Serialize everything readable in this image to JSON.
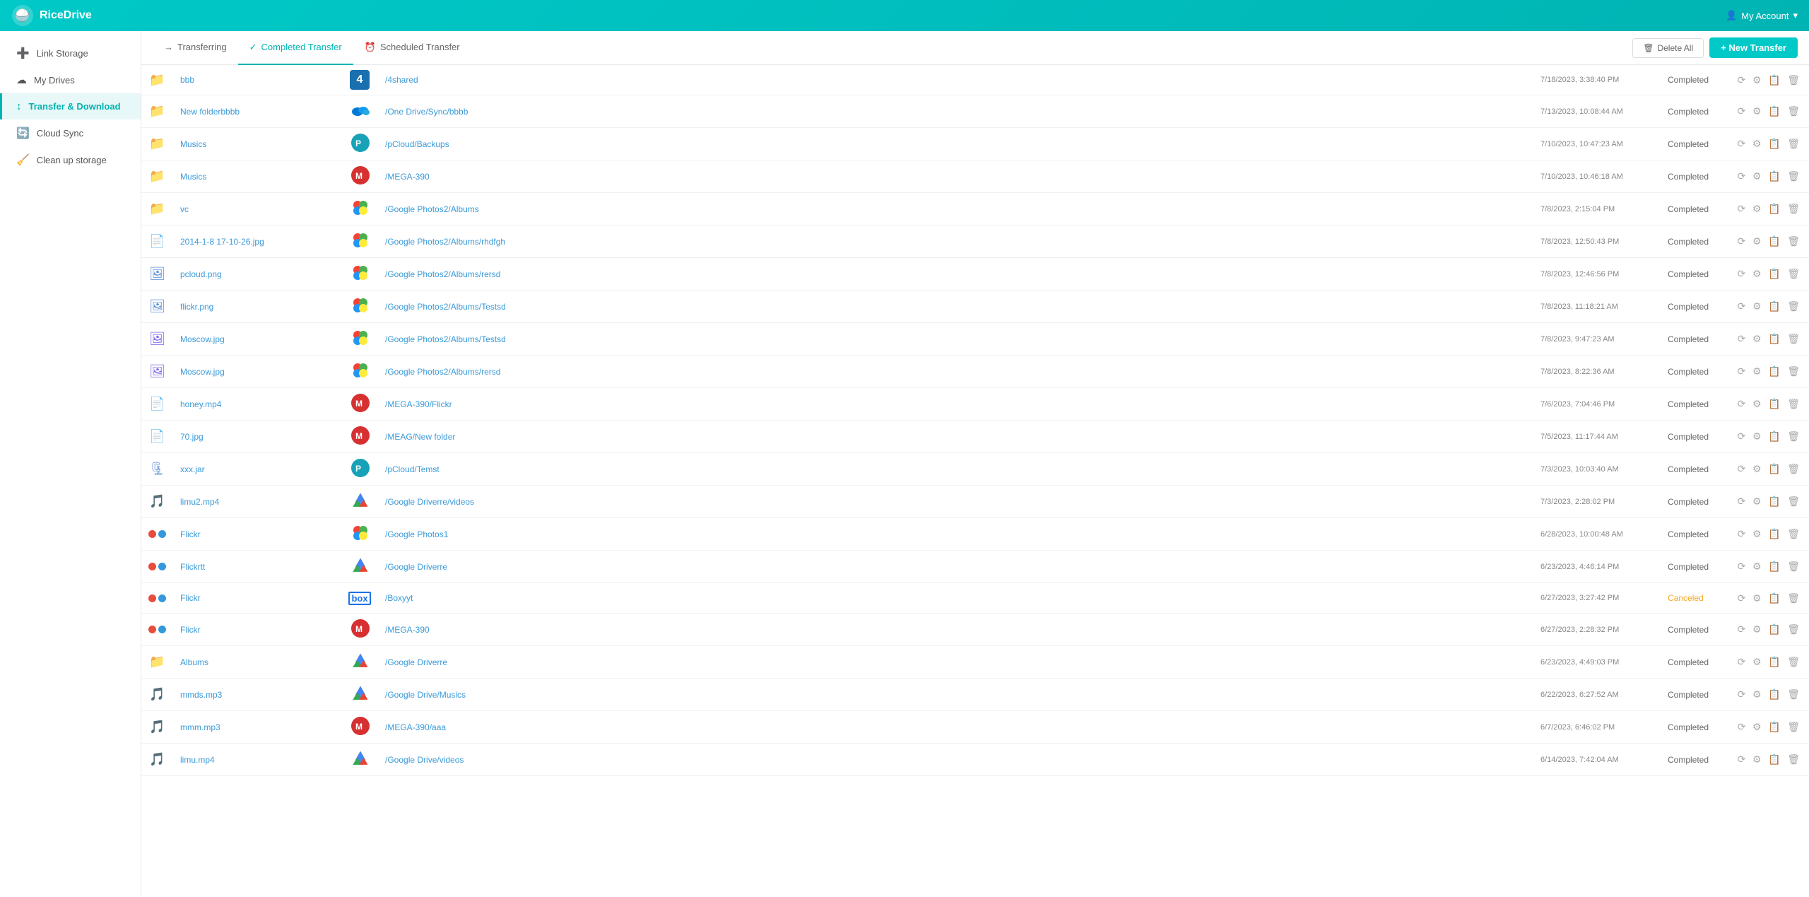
{
  "app": {
    "title": "RiceDrive",
    "logo_alt": "RiceDrive Logo"
  },
  "header": {
    "account_label": "My Account"
  },
  "sidebar": {
    "items": [
      {
        "id": "link-storage",
        "label": "Link Storage",
        "icon": "➕",
        "active": false
      },
      {
        "id": "my-drives",
        "label": "My Drives",
        "icon": "☁",
        "active": false
      },
      {
        "id": "transfer-download",
        "label": "Transfer & Download",
        "icon": "↕",
        "active": true
      },
      {
        "id": "cloud-sync",
        "label": "Cloud Sync",
        "icon": "🔄",
        "active": false
      },
      {
        "id": "clean-up-storage",
        "label": "Clean up storage",
        "icon": "🧹",
        "active": false
      }
    ]
  },
  "tabs": [
    {
      "id": "transferring",
      "label": "Transferring",
      "icon": "→",
      "active": false
    },
    {
      "id": "completed-transfer",
      "label": "Completed Transfer",
      "icon": "✓",
      "active": true
    },
    {
      "id": "scheduled-transfer",
      "label": "Scheduled Transfer",
      "icon": "⏰",
      "active": false
    }
  ],
  "toolbar": {
    "delete_all_label": "Delete All",
    "new_transfer_label": "+ New Transfer"
  },
  "table": {
    "rows": [
      {
        "id": 1,
        "file_icon": "folder",
        "name": "bbb",
        "source_type": "4shared",
        "destination": "/4shared",
        "date": "7/18/2023, 3:38:40 PM",
        "status": "Completed",
        "status_type": "completed"
      },
      {
        "id": 2,
        "file_icon": "folder",
        "name": "New folderbbbb",
        "source_type": "onedrive",
        "destination": "/One Drive/Sync/bbbb",
        "date": "7/13/2023, 10:08:44 AM",
        "status": "Completed",
        "status_type": "completed"
      },
      {
        "id": 3,
        "file_icon": "folder",
        "name": "Musics",
        "source_type": "pcloud",
        "destination": "/pCloud/Backups",
        "date": "7/10/2023, 10:47:23 AM",
        "status": "Completed",
        "status_type": "completed"
      },
      {
        "id": 4,
        "file_icon": "folder",
        "name": "Musics",
        "source_type": "mega",
        "destination": "/MEGA-390",
        "date": "7/10/2023, 10:46:18 AM",
        "status": "Completed",
        "status_type": "completed"
      },
      {
        "id": 5,
        "file_icon": "folder",
        "name": "vc",
        "source_type": "googlephotos",
        "destination": "/Google Photos2/Albums",
        "date": "7/8/2023, 2:15:04 PM",
        "status": "Completed",
        "status_type": "completed"
      },
      {
        "id": 6,
        "file_icon": "file",
        "name": "2014-1-8 17-10-26.jpg",
        "source_type": "googlephotos",
        "destination": "/Google Photos2/Albums/rhdfgh",
        "date": "7/8/2023, 12:50:43 PM",
        "status": "Completed",
        "status_type": "completed"
      },
      {
        "id": 7,
        "file_icon": "image",
        "name": "pcloud.png",
        "source_type": "googlephotos",
        "destination": "/Google Photos2/Albums/rersd",
        "date": "7/8/2023, 12:46:56 PM",
        "status": "Completed",
        "status_type": "completed"
      },
      {
        "id": 8,
        "file_icon": "image",
        "name": "flickr.png",
        "source_type": "googlephotos",
        "destination": "/Google Photos2/Albums/Testsd",
        "date": "7/8/2023, 11:18:21 AM",
        "status": "Completed",
        "status_type": "completed"
      },
      {
        "id": 9,
        "file_icon": "image2",
        "name": "Moscow.jpg",
        "source_type": "googlephotos",
        "destination": "/Google Photos2/Albums/Testsd",
        "date": "7/8/2023, 9:47:23 AM",
        "status": "Completed",
        "status_type": "completed"
      },
      {
        "id": 10,
        "file_icon": "image2",
        "name": "Moscow.jpg",
        "source_type": "googlephotos",
        "destination": "/Google Photos2/Albums/rersd",
        "date": "7/8/2023, 8:22:36 AM",
        "status": "Completed",
        "status_type": "completed"
      },
      {
        "id": 11,
        "file_icon": "file",
        "name": "honey.mp4",
        "source_type": "mega",
        "destination": "/MEGA-390/Flickr",
        "date": "7/6/2023, 7:04:46 PM",
        "status": "Completed",
        "status_type": "completed"
      },
      {
        "id": 12,
        "file_icon": "file",
        "name": "70.jpg",
        "source_type": "mega",
        "destination": "/MEAG/New folder",
        "date": "7/5/2023, 11:17:44 AM",
        "status": "Completed",
        "status_type": "completed"
      },
      {
        "id": 13,
        "file_icon": "zip",
        "name": "xxx.jar",
        "source_type": "pcloud",
        "destination": "/pCloud/Temst",
        "date": "7/3/2023, 10:03:40 AM",
        "status": "Completed",
        "status_type": "completed"
      },
      {
        "id": 14,
        "file_icon": "video",
        "name": "limu2.mp4",
        "source_type": "googledrive",
        "destination": "/Google Driverre/videos",
        "date": "7/3/2023, 2:28:02 PM",
        "status": "Completed",
        "status_type": "completed"
      },
      {
        "id": 15,
        "file_icon": "multi",
        "name": "Flickr",
        "source_type": "googlephotos",
        "destination": "/Google Photos1",
        "date": "6/28/2023, 10:00:48 AM",
        "status": "Completed",
        "status_type": "completed"
      },
      {
        "id": 16,
        "file_icon": "multi",
        "name": "Flickrtt",
        "source_type": "googledrive",
        "destination": "/Google Driverre",
        "date": "6/23/2023, 4:46:14 PM",
        "status": "Completed",
        "status_type": "completed"
      },
      {
        "id": 17,
        "file_icon": "multi",
        "name": "Flickr",
        "source_type": "box",
        "destination": "/Boxyyt",
        "date": "6/27/2023, 3:27:42 PM",
        "status": "Canceled",
        "status_type": "canceled"
      },
      {
        "id": 18,
        "file_icon": "multi",
        "name": "Flickr",
        "source_type": "mega",
        "destination": "/MEGA-390",
        "date": "6/27/2023, 2:28:32 PM",
        "status": "Completed",
        "status_type": "completed"
      },
      {
        "id": 19,
        "file_icon": "folder",
        "name": "Albums",
        "source_type": "googledrive",
        "destination": "/Google Driverre",
        "date": "6/23/2023, 4:49:03 PM",
        "status": "Completed",
        "status_type": "completed"
      },
      {
        "id": 20,
        "file_icon": "video",
        "name": "mmds.mp3",
        "source_type": "googledrive",
        "destination": "/Google Drive/Musics",
        "date": "6/22/2023, 6:27:52 AM",
        "status": "Completed",
        "status_type": "completed"
      },
      {
        "id": 21,
        "file_icon": "video",
        "name": "mmm.mp3",
        "source_type": "mega",
        "destination": "/MEGA-390/aaa",
        "date": "6/7/2023, 6:46:02 PM",
        "status": "Completed",
        "status_type": "completed"
      },
      {
        "id": 22,
        "file_icon": "video",
        "name": "limu.mp4",
        "source_type": "googledrive",
        "destination": "/Google Drive/videos",
        "date": "6/14/2023, 7:42:04 AM",
        "status": "Completed",
        "status_type": "completed"
      }
    ]
  }
}
